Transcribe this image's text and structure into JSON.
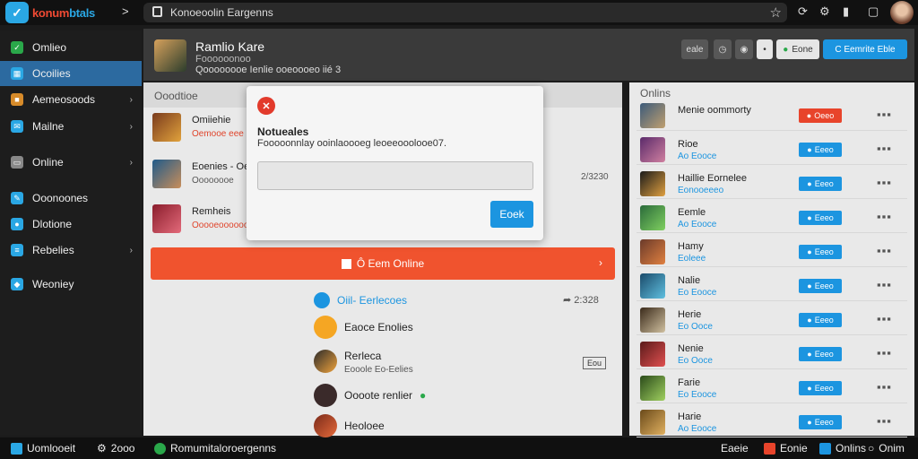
{
  "app": {
    "logo_part1": "konum",
    "logo_part2": "btals",
    "logo_mark": "✓",
    "url": "Konoeoolin Eargenns"
  },
  "sidebar": {
    "items": [
      {
        "label": "Omlieo",
        "color": "#2aa84a",
        "icon": "check-icon"
      },
      {
        "label": "Ocoilies",
        "color": "#2aa7e4",
        "icon": "grid-icon",
        "active": true
      },
      {
        "label": "Aemeosoods",
        "color": "#d78b2a",
        "icon": "folder-icon",
        "chevron": true
      },
      {
        "label": "Mailne",
        "color": "#2aa7e4",
        "icon": "mail-icon",
        "chevron": true
      },
      {
        "label": "Online",
        "color": "#888888",
        "icon": "screen-icon",
        "chevron": true
      },
      {
        "label": "Ooonoones",
        "color": "#2aa7e4",
        "icon": "pen-icon"
      },
      {
        "label": "Dlotione",
        "color": "#2aa7e4",
        "icon": "user-icon"
      },
      {
        "label": "Rebelies",
        "color": "#2aa7e4",
        "icon": "list-icon",
        "chevron": true
      },
      {
        "label": "Weoniey",
        "color": "#2aa7e4",
        "icon": "shield-icon"
      }
    ]
  },
  "profile": {
    "name": "Ramlio Kare",
    "sub": "Foooooonoo",
    "stats": "Qoooooooe Ienlie ooeoooeo iié 3",
    "buttons": [
      "eale",
      "",
      "",
      "",
      "Eone",
      "C Eemrite Eble"
    ]
  },
  "center": {
    "title": "Ooodtioe",
    "rows": [
      {
        "name": "Omiiehie",
        "sub": "Oemooe eee",
        "sub_color": "#e0442b"
      },
      {
        "name": "Eoenies - Oe",
        "sub": "Oooooooe",
        "sub_color": "#555555"
      },
      {
        "name": "Remheis",
        "sub": "Ooooeoooooo",
        "sub_color": "#e0442b"
      }
    ],
    "time": "2/3230",
    "banner": "Ô Eem Online",
    "chat_head": "Oiil- Eerlecoes",
    "chat_head_time": "2:328",
    "chats": [
      {
        "name": "Eaoce Enolies",
        "sub": ""
      },
      {
        "name": "Rerleca",
        "sub": "Eooole Eo-Eelies"
      },
      {
        "name": "Oooote renlier",
        "sub": ""
      },
      {
        "name": "Heoloee",
        "sub": ""
      }
    ],
    "tag": "Eou"
  },
  "modal": {
    "title": "Notueales",
    "message": "Fooooonnlay ooinlaoooeg leoeeooolooe07.",
    "button": "Eoek"
  },
  "right": {
    "title": "Onlins",
    "rows": [
      {
        "name": "Menie oommorty",
        "sub": "",
        "btn": "Oeeo",
        "btn_color": "#e8442b"
      },
      {
        "name": "Rioe",
        "sub": "Ao Eooce",
        "btn": "Eeeo",
        "btn_color": "#1c95e0"
      },
      {
        "name": "Haillie Eornelee",
        "sub": "Eonooeeeo",
        "btn": "Eeeo",
        "btn_color": "#1c95e0"
      },
      {
        "name": "Eemle",
        "sub": "Ao Eooce",
        "btn": "Eeeo",
        "btn_color": "#1c95e0"
      },
      {
        "name": "Hamy",
        "sub": "Eoleee",
        "btn": "Eeeo",
        "btn_color": "#1c95e0"
      },
      {
        "name": "Nalie",
        "sub": "Eo Eooce",
        "btn": "Eeeo",
        "btn_color": "#1c95e0"
      },
      {
        "name": "Herie",
        "sub": "Eo Ooce",
        "btn": "Eeeo",
        "btn_color": "#1c95e0"
      },
      {
        "name": "Nenie",
        "sub": "Eo Ooce",
        "btn": "Eeeo",
        "btn_color": "#1c95e0"
      },
      {
        "name": "Farie",
        "sub": "Eo Eooce",
        "btn": "Eeeo",
        "btn_color": "#1c95e0"
      },
      {
        "name": "Harie",
        "sub": "Ao Eooce",
        "btn": "Eeeo",
        "btn_color": "#1c95e0"
      }
    ]
  },
  "bottombar": {
    "left_label": "Uomlooeit",
    "left_count": "2ooo",
    "center": "Romumitaloroergenns",
    "right_count": "Eaeie",
    "right_items": [
      "Eonie",
      "Onlins",
      "Onim"
    ]
  }
}
